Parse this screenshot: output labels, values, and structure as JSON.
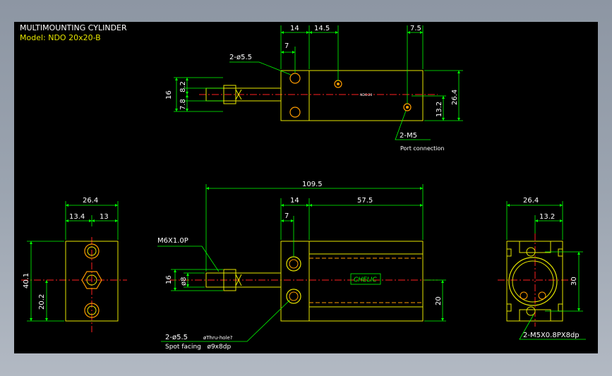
{
  "header": {
    "title": "MULTIMOUNTING CYLINDER",
    "model": "Model: NDO 20x20-B"
  },
  "top_view": {
    "dims": [
      "14",
      "14.5",
      "7.5",
      "7",
      "16",
      "7.8",
      "8.2",
      "26.4",
      "13.2"
    ],
    "hole_label": "2-ø5.5",
    "port_label": "2-M5",
    "port_note": "Port connection",
    "body_mark": "NDO.20"
  },
  "left_view": {
    "dims": [
      "26.4",
      "13.4",
      "13",
      "40.1",
      "20.2"
    ]
  },
  "front_view": {
    "dims": [
      "109.5",
      "14",
      "57.5",
      "7",
      "16",
      "ø8",
      "20"
    ],
    "thread_label": "M6X1.0P",
    "hole_label": "2-ø5.5",
    "hole_note": "øThru-hole?",
    "spot_label": "Spot facing   ø9x8dp",
    "logo": "CHELIC"
  },
  "right_view": {
    "dims": [
      "26.4",
      "13.2",
      "30"
    ],
    "tap_label": "2-M5X0.8PX8dp"
  },
  "colors": {
    "background": "#000000",
    "outline": "#e6e600",
    "dimension": "#00ff00",
    "centerline": "#ff2020",
    "hole": "#ff9c00",
    "text": "#ffffff"
  }
}
